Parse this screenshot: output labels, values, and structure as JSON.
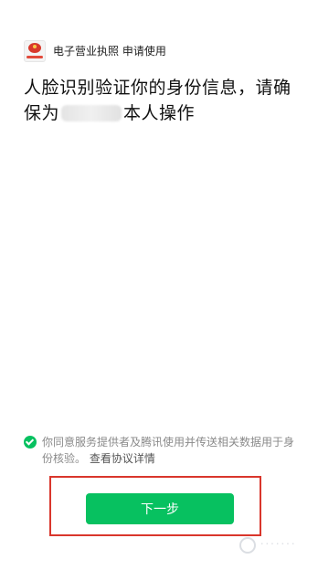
{
  "app": {
    "name": "电子营业执照 申请使用",
    "logo_icon": "business-license-logo"
  },
  "headline": {
    "line1": "人脸识别验证你的身份信息，请确",
    "line2_prefix": "保为",
    "line2_suffix": "本人操作"
  },
  "consent": {
    "text": "你同意服务提供者及腾讯使用并传送相关数据用于身份核验。",
    "link_label": "查看协议详情",
    "checked": true,
    "check_color": "#07c160"
  },
  "actions": {
    "next_label": "下一步",
    "button_color": "#07c160",
    "highlight_color": "#d9362c"
  }
}
